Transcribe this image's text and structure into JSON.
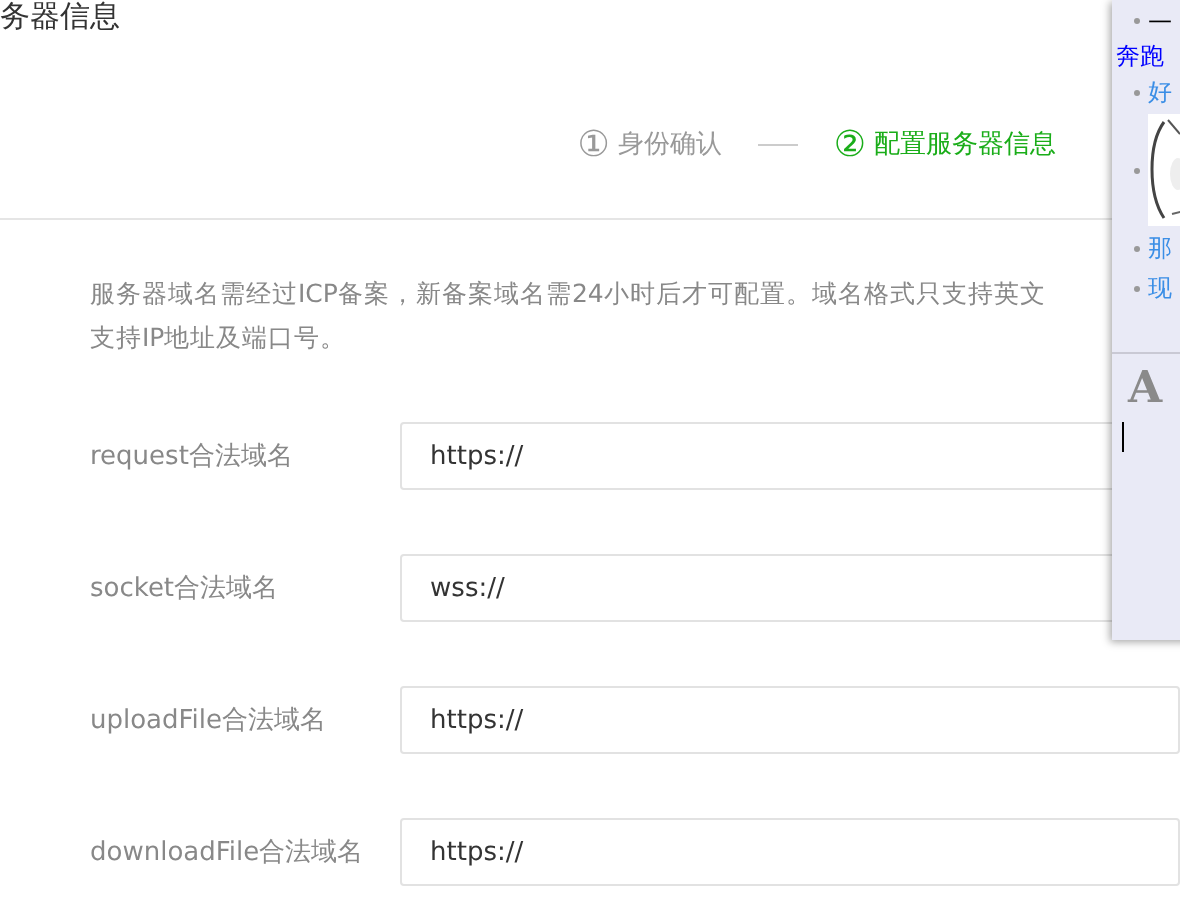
{
  "page_title": "务器信息",
  "steps": [
    {
      "number": "①",
      "label": "身份确认",
      "selected": false
    },
    {
      "number": "②",
      "label": "配置服务器信息",
      "selected": true
    }
  ],
  "notice": [
    "服务器域名需经过ICP备案，新备案域名需24小时后才可配置。域名格式只支持英文",
    "支持IP地址及端口号。"
  ],
  "fields": [
    {
      "label": "request合法域名",
      "value": "https://"
    },
    {
      "label": "socket合法域名",
      "value": "wss://"
    },
    {
      "label": "uploadFile合法域名",
      "value": "https://"
    },
    {
      "label": "downloadFile合法域名",
      "value": "https://"
    }
  ],
  "side_panel": {
    "items": [
      {
        "kind": "bullet",
        "text": "—"
      },
      {
        "kind": "link",
        "text": "奔跑"
      },
      {
        "kind": "bullet",
        "text": "好"
      },
      {
        "kind": "picture"
      },
      {
        "kind": "bullet",
        "text": "那"
      },
      {
        "kind": "bullet",
        "text": "现"
      }
    ],
    "font_icon": "A"
  }
}
